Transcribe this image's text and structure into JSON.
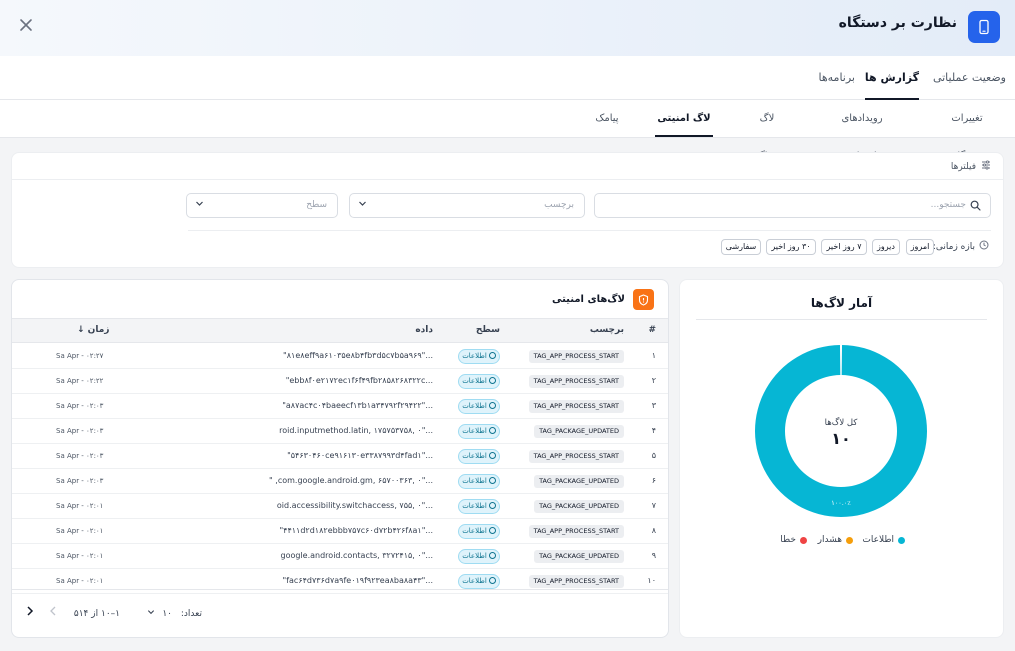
{
  "header": {
    "title": "نظارت بر دستگاه",
    "close_icon": "close-icon",
    "app_icon": "smartphone-icon",
    "accent": "#2563eb"
  },
  "main_tabs": [
    {
      "label": "وضعیت عملیاتی",
      "active": false
    },
    {
      "label": "گزارش ها",
      "active": true
    },
    {
      "label": "برنامه‌ها",
      "active": false
    }
  ],
  "sub_tabs": [
    {
      "label": "تغییرات دستگاه",
      "active": false
    },
    {
      "label": "رویدادهای کنترلی",
      "active": false
    },
    {
      "label": "لاگ دیباگ",
      "active": false
    },
    {
      "label": "لاگ امنیتی",
      "active": true
    },
    {
      "label": "پیامک",
      "active": false
    }
  ],
  "filters": {
    "title": "فیلترها",
    "search_placeholder": "جستجو...",
    "tag_placeholder": "برچسب",
    "level_placeholder": "سطح",
    "range_label": "بازه زمانی:",
    "chips": [
      "امروز",
      "دیروز",
      "۷ روز اخیر",
      "۳۰ روز اخیر",
      "سفارشی"
    ]
  },
  "stats": {
    "title": "آمار لاگ‌ها",
    "center_label": "کل لاگ‌ها",
    "center_value": "۱۰",
    "slice_label": "۱۰۰.۰٪",
    "legend": [
      {
        "label": "اطلاعات",
        "color": "#06b6d4"
      },
      {
        "label": "هشدار",
        "color": "#f59e0b"
      },
      {
        "label": "خطا",
        "color": "#ef4444"
      }
    ]
  },
  "chart_data": {
    "type": "pie",
    "categories": [
      "اطلاعات",
      "هشدار",
      "خطا"
    ],
    "values": [
      10,
      0,
      0
    ],
    "colors": [
      "#06b6d4",
      "#f59e0b",
      "#ef4444"
    ],
    "title": "آمار لاگ‌ها"
  },
  "logs": {
    "title": "لاگ‌های امنیتی",
    "columns": {
      "num": "#",
      "tag": "برچسب",
      "level": "سطح",
      "data": "داده",
      "time": "زمان ↓"
    },
    "rows": [
      {
        "num": "۱",
        "tag": "TAG_APP_PROCESS_START",
        "level": "اطلاعات",
        "data": "\"۸۱e۸eff۹a۶۱۰۳۵e۸b۴fb۳d۵c۷b۵a۹۶۹\"...",
        "time": "Sa Apr - ۰۲:۲۷"
      },
      {
        "num": "۲",
        "tag": "TAG_APP_PROCESS_START",
        "level": "اطلاعات",
        "data": "\"ebb۸f۰e۲۱۷۲ec۱f۶f۴۹fb۲۸۵۸۲۶۸۳۲۲c...",
        "time": "Sa Apr - ۰۲:۲۲"
      },
      {
        "num": "۳",
        "tag": "TAG_APP_PROCESS_START",
        "level": "اطلاعات",
        "data": "\"a۸۷ac۴c۰۴baeecf۱۳b۱a۳۴۷۹۲f۲۹۴۲۲\"...",
        "time": "Sa Apr - ۰۲:۰۳"
      },
      {
        "num": "۴",
        "tag": "TAG_PACKAGE_UPDATED",
        "level": "اطلاعات",
        "data": "roid.inputmethod.latin, ۱۷۵۷۵۳۷۵۸, ۰\"...",
        "time": "Sa Apr - ۰۲:۰۳"
      },
      {
        "num": "۵",
        "tag": "TAG_APP_PROCESS_START",
        "level": "اطلاعات",
        "data": "\"۵۴۶۳۰۴۶۰ce۹۱۶۱۳۰e۳۳۸۷۹۹۳d۴fad۱\"...",
        "time": "Sa Apr - ۰۲:۰۳"
      },
      {
        "num": "۶",
        "tag": "TAG_PACKAGE_UPDATED",
        "level": "اطلاعات",
        "data": "\" ,com.google.android.gm, ۶۵۷۰۰۳۶۳, ۰\"...",
        "time": "Sa Apr - ۰۲:۰۳"
      },
      {
        "num": "۷",
        "tag": "TAG_PACKAGE_UPDATED",
        "level": "اطلاعات",
        "data": "oid.accessibility.switchaccess, ۷۵۵, ۰\"...",
        "time": "Sa Apr - ۰۲:۰۱"
      },
      {
        "num": "۸",
        "tag": "TAG_APP_PROCESS_START",
        "level": "اطلاعات",
        "data": "\"۴۴۱۱d۲d۱۸۲ebbb۷۵۷c۶۰d۷۲b۴۲۶f۸a۱\"...",
        "time": "Sa Apr - ۰۲:۰۱"
      },
      {
        "num": "۹",
        "tag": "TAG_PACKAGE_UPDATED",
        "level": "اطلاعات",
        "data": "google.android.contacts, ۳۲۷۲۴۱۵, ۰\"...",
        "time": "Sa Apr - ۰۲:۰۱"
      },
      {
        "num": "۱۰",
        "tag": "TAG_APP_PROCESS_START",
        "level": "اطلاعات",
        "data": "\"fac۶۴d۷۳۶d۷a۹fe۰۱۹f۹۲۳ea۸ba۸a۴۳\"...",
        "time": "Sa Apr - ۰۲:۰۱"
      }
    ]
  },
  "pager": {
    "count_label": "تعداد:",
    "page_size": "۱۰",
    "range": "۱–۱۰ از ۵۱۴",
    "prev_icon": "chevron-left-icon",
    "next_icon": "chevron-right-icon"
  }
}
